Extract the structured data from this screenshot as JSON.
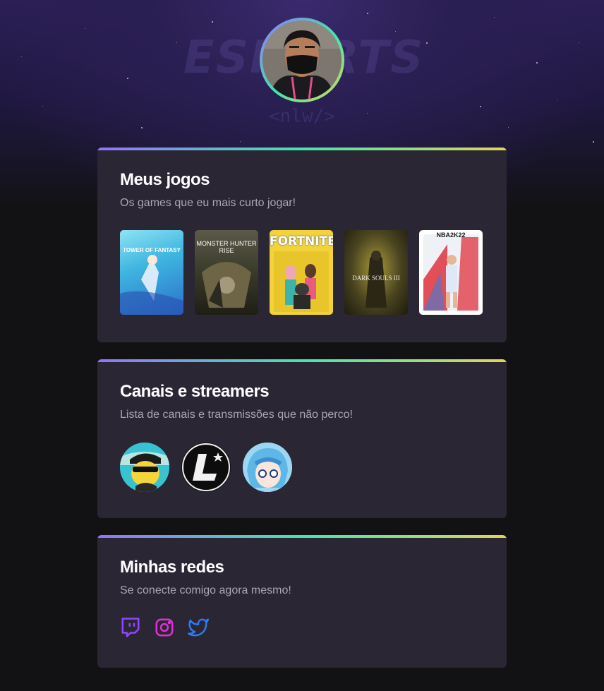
{
  "hero": {
    "watermark_text": "ESPORTS",
    "watermark_sub": "<nlw/>"
  },
  "profile": {
    "avatar_icon": "avatar-photo"
  },
  "games_section": {
    "title": "Meus jogos",
    "subtitle": "Os games que eu mais curto jogar!",
    "games": [
      {
        "name": "Tower of Fantasy",
        "cover_text": "TOWER OF FANTASY",
        "color": "#3fb6e0"
      },
      {
        "name": "Monster Hunter Rise",
        "cover_text": "MONSTER HUNTER RISE",
        "color": "#3a3a2a"
      },
      {
        "name": "Fortnite",
        "cover_text": "FORTNITE",
        "color": "#f2d43a"
      },
      {
        "name": "Dark Souls III",
        "cover_text": "DARK SOULS III",
        "color": "#4a4420"
      },
      {
        "name": "NBA 2K22",
        "cover_text": "NBA2K22",
        "color": "#ffffff"
      }
    ]
  },
  "channels_section": {
    "title": "Canais e streamers",
    "subtitle": "Lista de canais e transmissões que não perco!",
    "channels": [
      {
        "icon": "cartoon-avatar",
        "color": "#2fc1d6"
      },
      {
        "icon": "letter-l-logo",
        "color": "#111111"
      },
      {
        "icon": "anime-avatar",
        "color": "#7fc9ef"
      }
    ]
  },
  "social_section": {
    "title": "Minhas redes",
    "subtitle": "Se conecte comigo agora mesmo!",
    "links": [
      {
        "icon": "twitch-icon",
        "color": "#9146ff"
      },
      {
        "icon": "instagram-icon",
        "color": "#e130d7"
      },
      {
        "icon": "twitter-icon",
        "color": "#2d7cf2"
      }
    ]
  }
}
